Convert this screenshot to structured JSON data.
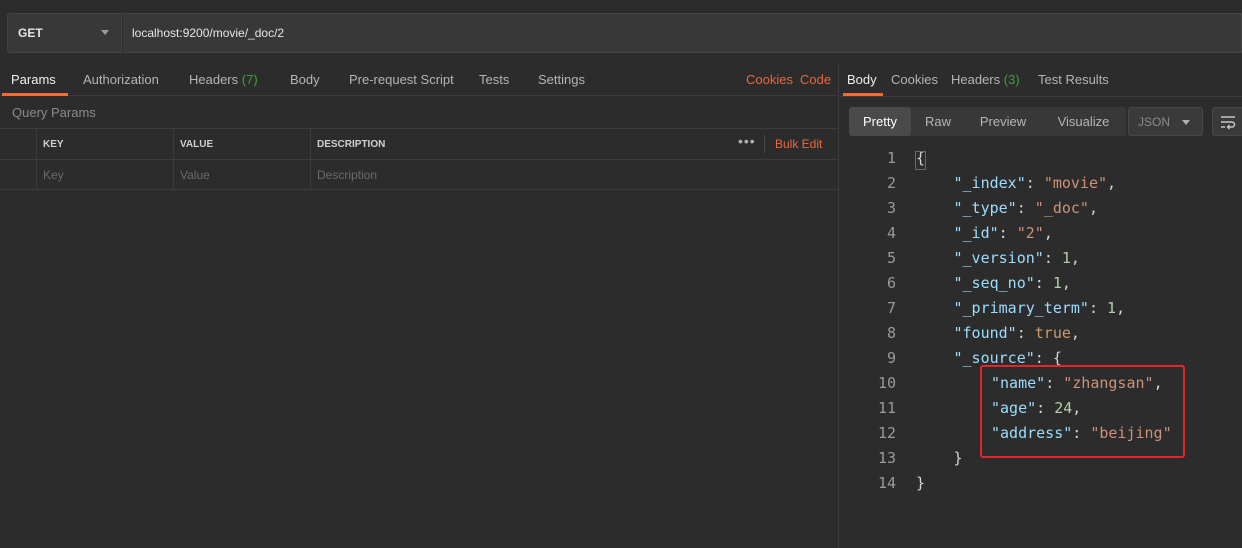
{
  "request": {
    "method": "GET",
    "url": "localhost:9200/movie/_doc/2"
  },
  "request_tabs": [
    {
      "label": "Params",
      "count": ""
    },
    {
      "label": "Authorization",
      "count": ""
    },
    {
      "label": "Headers",
      "count": "(7)"
    },
    {
      "label": "Body",
      "count": ""
    },
    {
      "label": "Pre-request Script",
      "count": ""
    },
    {
      "label": "Tests",
      "count": ""
    },
    {
      "label": "Settings",
      "count": ""
    }
  ],
  "links": {
    "cookies": "Cookies",
    "code": "Code"
  },
  "query_params": {
    "title": "Query Params",
    "headers": {
      "key": "KEY",
      "value": "VALUE",
      "description": "DESCRIPTION"
    },
    "placeholders": {
      "key": "Key",
      "value": "Value",
      "description": "Description"
    },
    "more": "•••",
    "bulk_edit": "Bulk Edit"
  },
  "response_tabs": [
    {
      "label": "Body",
      "count": ""
    },
    {
      "label": "Cookies",
      "count": ""
    },
    {
      "label": "Headers",
      "count": "(3)"
    },
    {
      "label": "Test Results",
      "count": ""
    }
  ],
  "view_modes": [
    "Pretty",
    "Raw",
    "Preview",
    "Visualize"
  ],
  "format": "JSON",
  "response_body": [
    {
      "n": "1",
      "indent": 0,
      "parts": [
        [
          "p",
          "{"
        ]
      ]
    },
    {
      "n": "2",
      "indent": 1,
      "parts": [
        [
          "k",
          "\"_index\""
        ],
        [
          "p",
          ": "
        ],
        [
          "s",
          "\"movie\""
        ],
        [
          "p",
          ","
        ]
      ]
    },
    {
      "n": "3",
      "indent": 1,
      "parts": [
        [
          "k",
          "\"_type\""
        ],
        [
          "p",
          ": "
        ],
        [
          "s",
          "\"_doc\""
        ],
        [
          "p",
          ","
        ]
      ]
    },
    {
      "n": "4",
      "indent": 1,
      "parts": [
        [
          "k",
          "\"_id\""
        ],
        [
          "p",
          ": "
        ],
        [
          "s",
          "\"2\""
        ],
        [
          "p",
          ","
        ]
      ]
    },
    {
      "n": "5",
      "indent": 1,
      "parts": [
        [
          "k",
          "\"_version\""
        ],
        [
          "p",
          ": "
        ],
        [
          "n",
          "1"
        ],
        [
          "p",
          ","
        ]
      ]
    },
    {
      "n": "6",
      "indent": 1,
      "parts": [
        [
          "k",
          "\"_seq_no\""
        ],
        [
          "p",
          ": "
        ],
        [
          "n",
          "1"
        ],
        [
          "p",
          ","
        ]
      ]
    },
    {
      "n": "7",
      "indent": 1,
      "parts": [
        [
          "k",
          "\"_primary_term\""
        ],
        [
          "p",
          ": "
        ],
        [
          "n",
          "1"
        ],
        [
          "p",
          ","
        ]
      ]
    },
    {
      "n": "8",
      "indent": 1,
      "parts": [
        [
          "k",
          "\"found\""
        ],
        [
          "p",
          ": "
        ],
        [
          "b",
          "true"
        ],
        [
          "p",
          ","
        ]
      ]
    },
    {
      "n": "9",
      "indent": 1,
      "parts": [
        [
          "k",
          "\"_source\""
        ],
        [
          "p",
          ": {"
        ]
      ]
    },
    {
      "n": "10",
      "indent": 2,
      "parts": [
        [
          "k",
          "\"name\""
        ],
        [
          "p",
          ": "
        ],
        [
          "s",
          "\"zhangsan\""
        ],
        [
          "p",
          ","
        ]
      ]
    },
    {
      "n": "11",
      "indent": 2,
      "parts": [
        [
          "k",
          "\"age\""
        ],
        [
          "p",
          ": "
        ],
        [
          "n",
          "24"
        ],
        [
          "p",
          ","
        ]
      ]
    },
    {
      "n": "12",
      "indent": 2,
      "parts": [
        [
          "k",
          "\"address\""
        ],
        [
          "p",
          ": "
        ],
        [
          "s",
          "\"beijing\""
        ]
      ]
    },
    {
      "n": "13",
      "indent": 1,
      "parts": [
        [
          "p",
          "}"
        ]
      ]
    },
    {
      "n": "14",
      "indent": 0,
      "parts": [
        [
          "p",
          "}"
        ]
      ]
    }
  ],
  "colors": {
    "accent": "#f26b3a",
    "count_green": "#3ca33a",
    "highlight_box": "#e8242b"
  }
}
